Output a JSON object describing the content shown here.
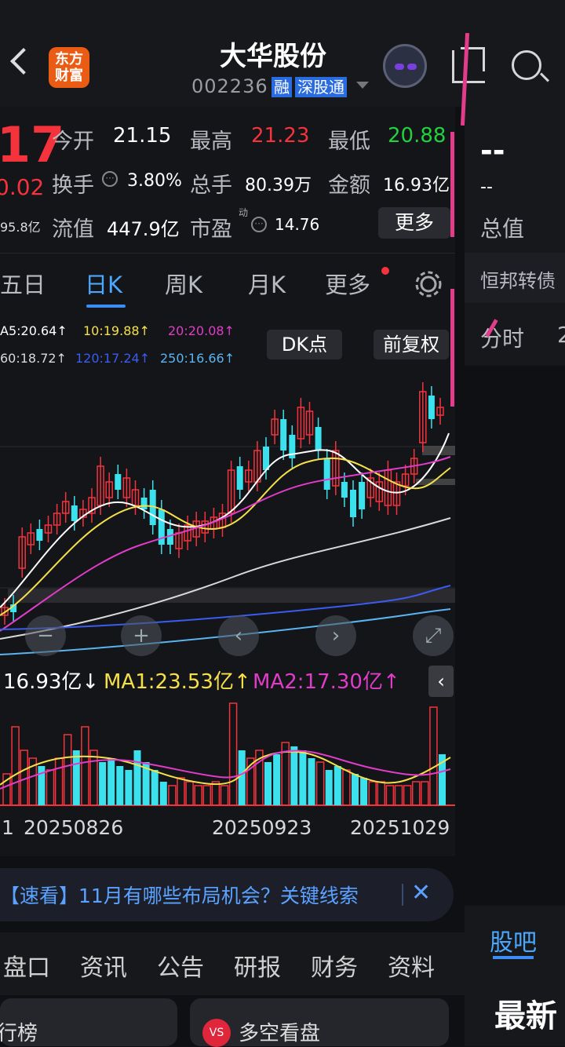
{
  "header": {
    "stock_name": "大华股份",
    "stock_code": "002236",
    "tag_rong": "融",
    "tag_sgt": "深股通",
    "logo_line1": "东方",
    "logo_line2": "财富"
  },
  "quote": {
    "price_partial": "17",
    "change_partial": "0.02",
    "mktcap_partial": "95.8亿",
    "open_label": "今开",
    "open_value": "21.15",
    "high_label": "最高",
    "high_value": "21.23",
    "low_label": "最低",
    "low_value": "20.88",
    "turnover_label": "换手",
    "turnover_value": "3.80%",
    "volume_label": "总手",
    "volume_value": "80.39万",
    "amount_label": "金额",
    "amount_value": "16.93亿",
    "float_label": "流值",
    "float_value": "447.9亿",
    "pe_label": "市盈",
    "pe_sup": "动",
    "pe_value": "14.76",
    "more_label": "更多"
  },
  "tabs": {
    "t1": "五日",
    "t2": "日K",
    "t3": "周K",
    "t4": "月K",
    "t5": "更多"
  },
  "ma": {
    "ma5": "A5:20.64↑",
    "ma10": "10:19.88↑",
    "ma20": "20:20.08↑",
    "ma60": "60:18.72↑",
    "ma120": "120:17.24↑",
    "ma250": "250:16.66↑"
  },
  "chart_buttons": {
    "dk": "DK点",
    "fq": "前复权"
  },
  "volume": {
    "current": "16.93亿↓",
    "ma1": "MA1:23.53亿↑",
    "ma2": "MA2:17.30亿↑"
  },
  "dates": {
    "d0": "1",
    "d1": "20250826",
    "d2": "20250923",
    "d3": "20251029"
  },
  "news": {
    "text": "【速看】11月有哪些布局机会？关键线索"
  },
  "bottom_tabs": [
    "盘口",
    "资讯",
    "公告",
    "研报",
    "财务",
    "资料"
  ],
  "cards": {
    "left": "行榜",
    "right": "多空看盘"
  },
  "right_panel": {
    "value_dash": "--",
    "value_dash2": "--",
    "total_label": "总值",
    "convertible": "恒邦转债",
    "fenshi": "分时",
    "guba": "股吧",
    "latest": "最新"
  },
  "colors": {
    "up": "#f4333c",
    "down": "#21d13d",
    "accent": "#3a8ef6",
    "ma5": "#ffffff",
    "ma10": "#f5e04a",
    "ma20": "#e03cc8",
    "ma60": "#d9d9d9",
    "ma120": "#3a5cf0",
    "ma250": "#5ab4f0"
  },
  "chart_data": {
    "type": "candlestick",
    "ma_colors": [
      "#ffffff",
      "#f5e04a",
      "#e03cc8",
      "#d9d9d9",
      "#3a5cf0",
      "#5ab4f0"
    ]
  }
}
